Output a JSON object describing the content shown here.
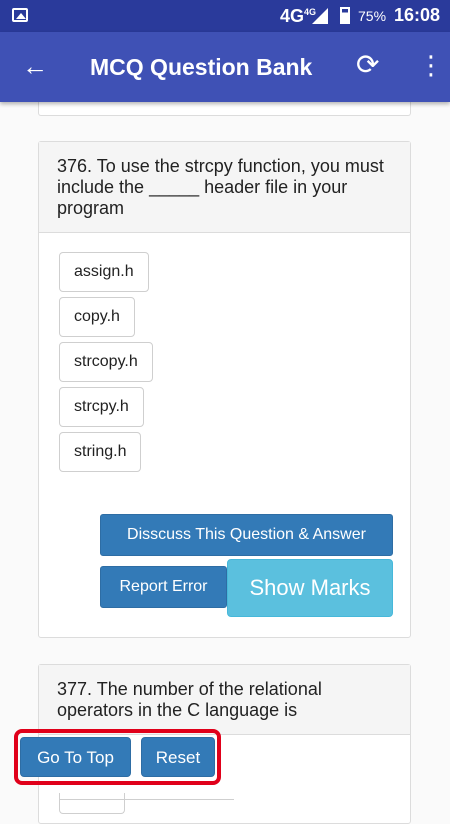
{
  "status_bar": {
    "network": "4G",
    "network_sup": "4G",
    "battery": "75%",
    "time": "16:08"
  },
  "app_bar": {
    "title": "MCQ Question Bank"
  },
  "questions": [
    {
      "text": "376. To use the strcpy function, you must include the _____ header file in your program",
      "options": [
        "assign.h",
        "copy.h",
        "strcopy.h",
        "strcpy.h",
        "string.h"
      ],
      "discuss_label": "Disscuss This Question & Answer",
      "report_label": "Report Error",
      "show_marks_label": "Show Marks"
    },
    {
      "text": "377. The number of the relational operators in the C language is"
    }
  ],
  "floating": {
    "go_to_top": "Go To Top",
    "reset": "Reset"
  },
  "colors": {
    "status_bar": "#2a3a9b",
    "app_bar": "#3f51b5",
    "primary_button": "#337ab7",
    "info_button": "#5bc0de",
    "highlight": "#e0001a"
  },
  "icons": {
    "back": "back-arrow-icon",
    "refresh": "refresh-icon",
    "more": "more-vert-icon"
  }
}
